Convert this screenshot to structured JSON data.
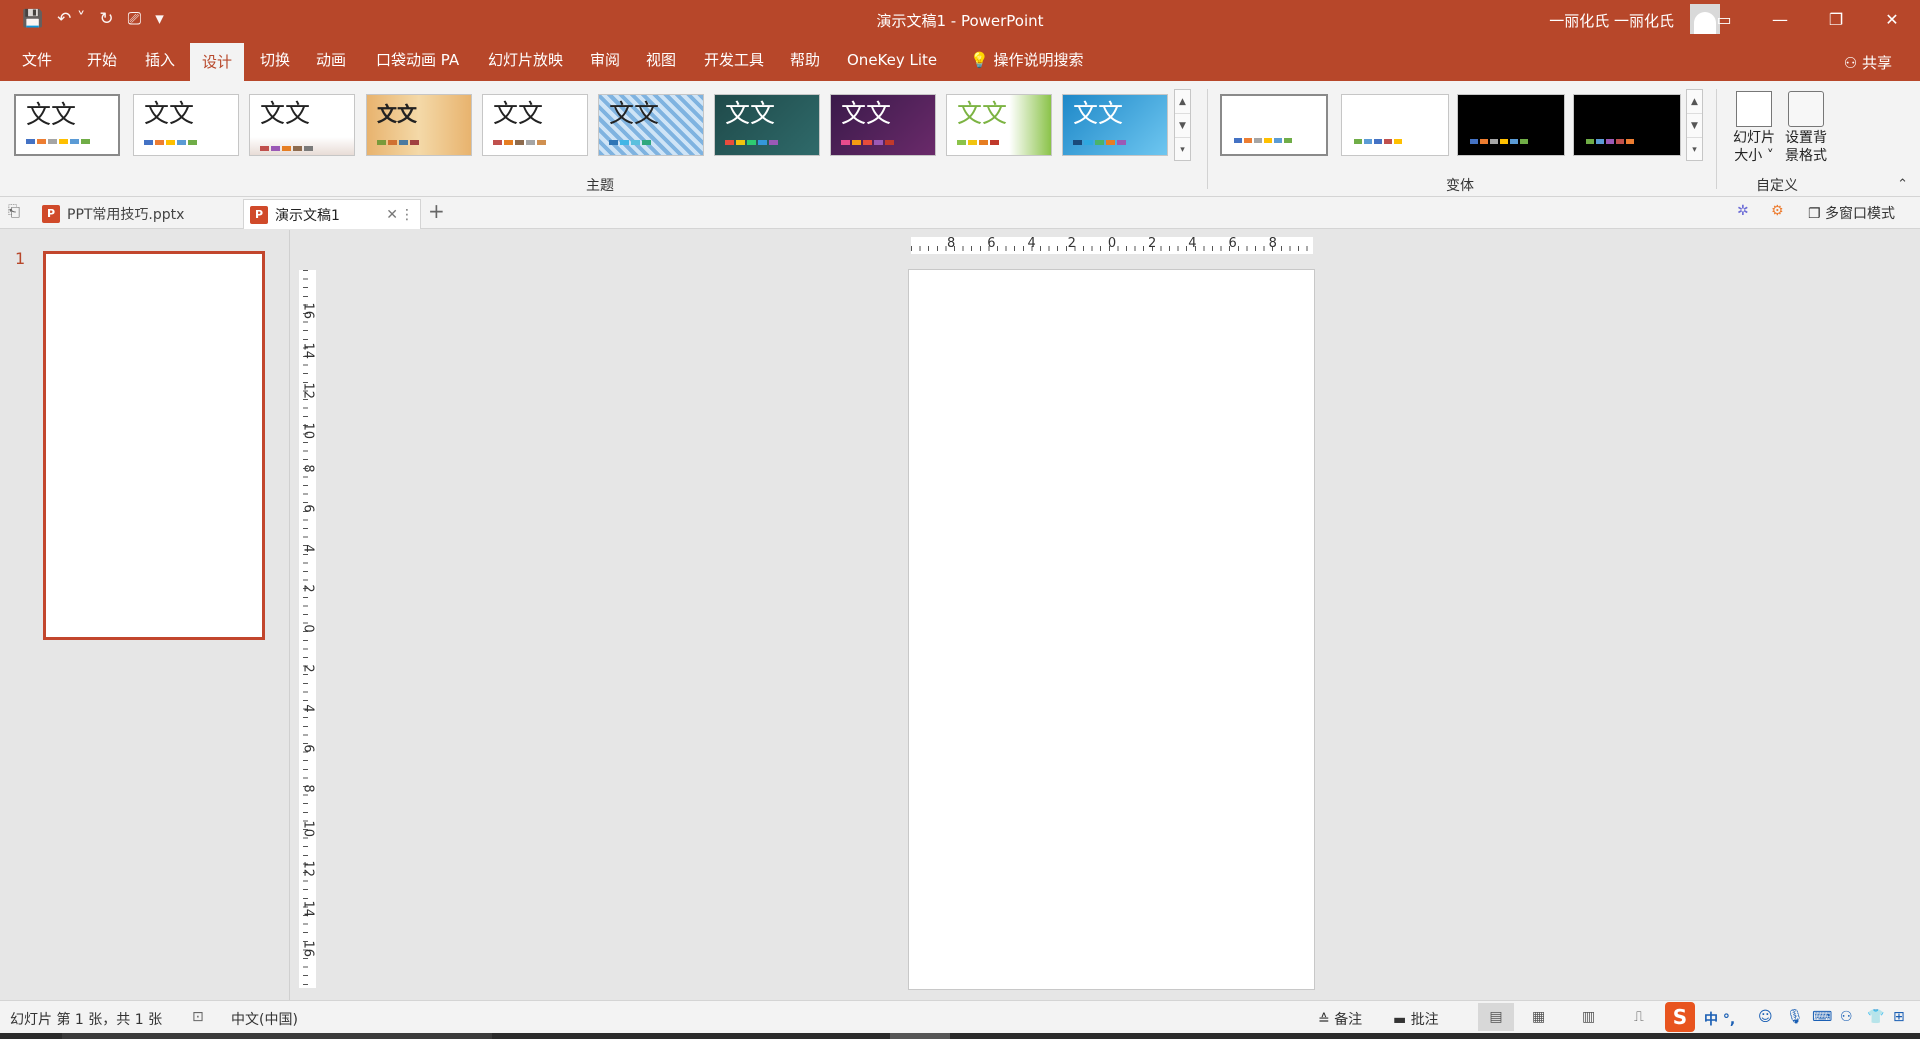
{
  "app": {
    "window_title": "演示文稿1  -  PowerPoint",
    "user_name": "一丽化氏 一丽化氏"
  },
  "ribbon": {
    "tabs": [
      {
        "label": "文件"
      },
      {
        "label": "开始"
      },
      {
        "label": "插入"
      },
      {
        "label": "设计",
        "active": true
      },
      {
        "label": "切换"
      },
      {
        "label": "动画"
      },
      {
        "label": "口袋动画 PA"
      },
      {
        "label": "幻灯片放映"
      },
      {
        "label": "审阅"
      },
      {
        "label": "视图"
      },
      {
        "label": "开发工具"
      },
      {
        "label": "帮助"
      },
      {
        "label": "OneKey Lite"
      },
      {
        "label": "操作说明搜索"
      }
    ],
    "share_label": "共享",
    "themes_group_label": "主题",
    "variants_group_label": "变体",
    "customize_group_label": "自定义",
    "theme_thumb_text": "文文",
    "slide_size_label_1": "幻灯片",
    "slide_size_label_2": "大小 ˅",
    "format_bg_label_1": "设置背",
    "format_bg_label_2": "景格式"
  },
  "documents": {
    "tabs": [
      {
        "label": "PPT常用技巧.pptx"
      },
      {
        "label": "演示文稿1",
        "active": true
      }
    ],
    "multi_window_label": "多窗口模式"
  },
  "slides_pane": {
    "slide_number": "1"
  },
  "rulers": {
    "horizontal_labels": [
      "8",
      "6",
      "4",
      "2",
      "0",
      "2",
      "4",
      "6",
      "8"
    ],
    "vertical_labels": [
      "16",
      "14",
      "12",
      "10",
      "8",
      "6",
      "4",
      "2",
      "0",
      "2",
      "4",
      "6",
      "8",
      "10",
      "12",
      "14",
      "16"
    ]
  },
  "status": {
    "slide_info": "幻灯片 第 1 张，共 1 张",
    "language": "中文(中国)",
    "notes_label": "备注",
    "comments_label": "批注",
    "ime_chars": "中 °,"
  },
  "colors": {
    "accent": "#b7472a",
    "ribbon_bg": "#f3f3f3",
    "workspace_bg": "#e6e6e6"
  }
}
